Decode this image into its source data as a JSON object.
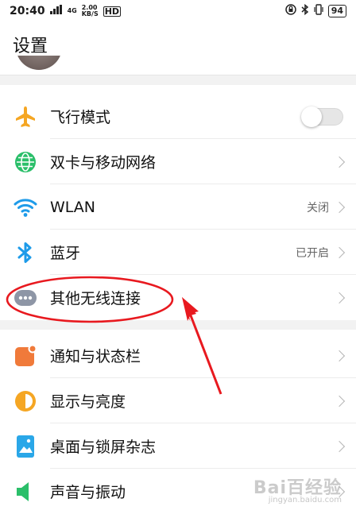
{
  "statusbar": {
    "time": "20:40",
    "network_sup": "4G",
    "speed_top": "2.00",
    "speed_unit": "KB/S",
    "hd": "HD",
    "battery": "94"
  },
  "page_title": "设置",
  "items": [
    {
      "label": "飞行模式",
      "icon": "airplane-icon",
      "toggle": "off"
    },
    {
      "label": "双卡与移动网络",
      "icon": "globe-icon"
    },
    {
      "label": "WLAN",
      "icon": "wifi-icon",
      "value": "关闭"
    },
    {
      "label": "蓝牙",
      "icon": "bluetooth-icon",
      "value": "已开启"
    },
    {
      "label": "其他无线连接",
      "icon": "more-dots-icon"
    },
    {
      "label": "通知与状态栏",
      "icon": "notification-icon"
    },
    {
      "label": "显示与亮度",
      "icon": "brightness-icon"
    },
    {
      "label": "桌面与锁屏杂志",
      "icon": "wallpaper-icon"
    },
    {
      "label": "声音与振动",
      "icon": "sound-icon"
    }
  ],
  "colors": {
    "accent_orange": "#f5a623",
    "green": "#2bbf6a",
    "wifi_blue": "#1e9be9",
    "annotation_red": "#e8191f"
  },
  "watermark": {
    "text": "Bai百经验",
    "sub": "jingyan.baidu.com"
  }
}
